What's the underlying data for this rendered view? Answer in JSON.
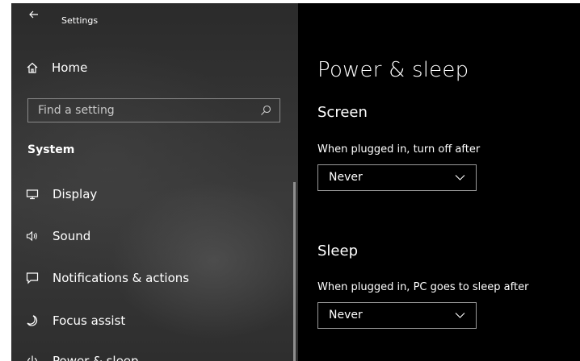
{
  "window": {
    "title": "Settings"
  },
  "sidebar": {
    "home_label": "Home",
    "search_placeholder": "Find a setting",
    "section_title": "System",
    "items": [
      {
        "label": "Display",
        "icon": "monitor-icon"
      },
      {
        "label": "Sound",
        "icon": "speaker-icon"
      },
      {
        "label": "Notifications & actions",
        "icon": "notifications-icon"
      },
      {
        "label": "Focus assist",
        "icon": "moon-icon"
      },
      {
        "label": "Power & sleep",
        "icon": "power-icon",
        "selected": true
      }
    ]
  },
  "main": {
    "title": "Power & sleep",
    "screen": {
      "heading": "Screen",
      "label": "When plugged in, turn off after",
      "value": "Never"
    },
    "sleep": {
      "heading": "Sleep",
      "label": "When plugged in, PC goes to sleep after",
      "value": "Never"
    }
  },
  "colors": {
    "sidebar_bg": "#333333",
    "main_bg": "#000000",
    "accent": "#6b4fbb",
    "text": "#ffffff"
  }
}
